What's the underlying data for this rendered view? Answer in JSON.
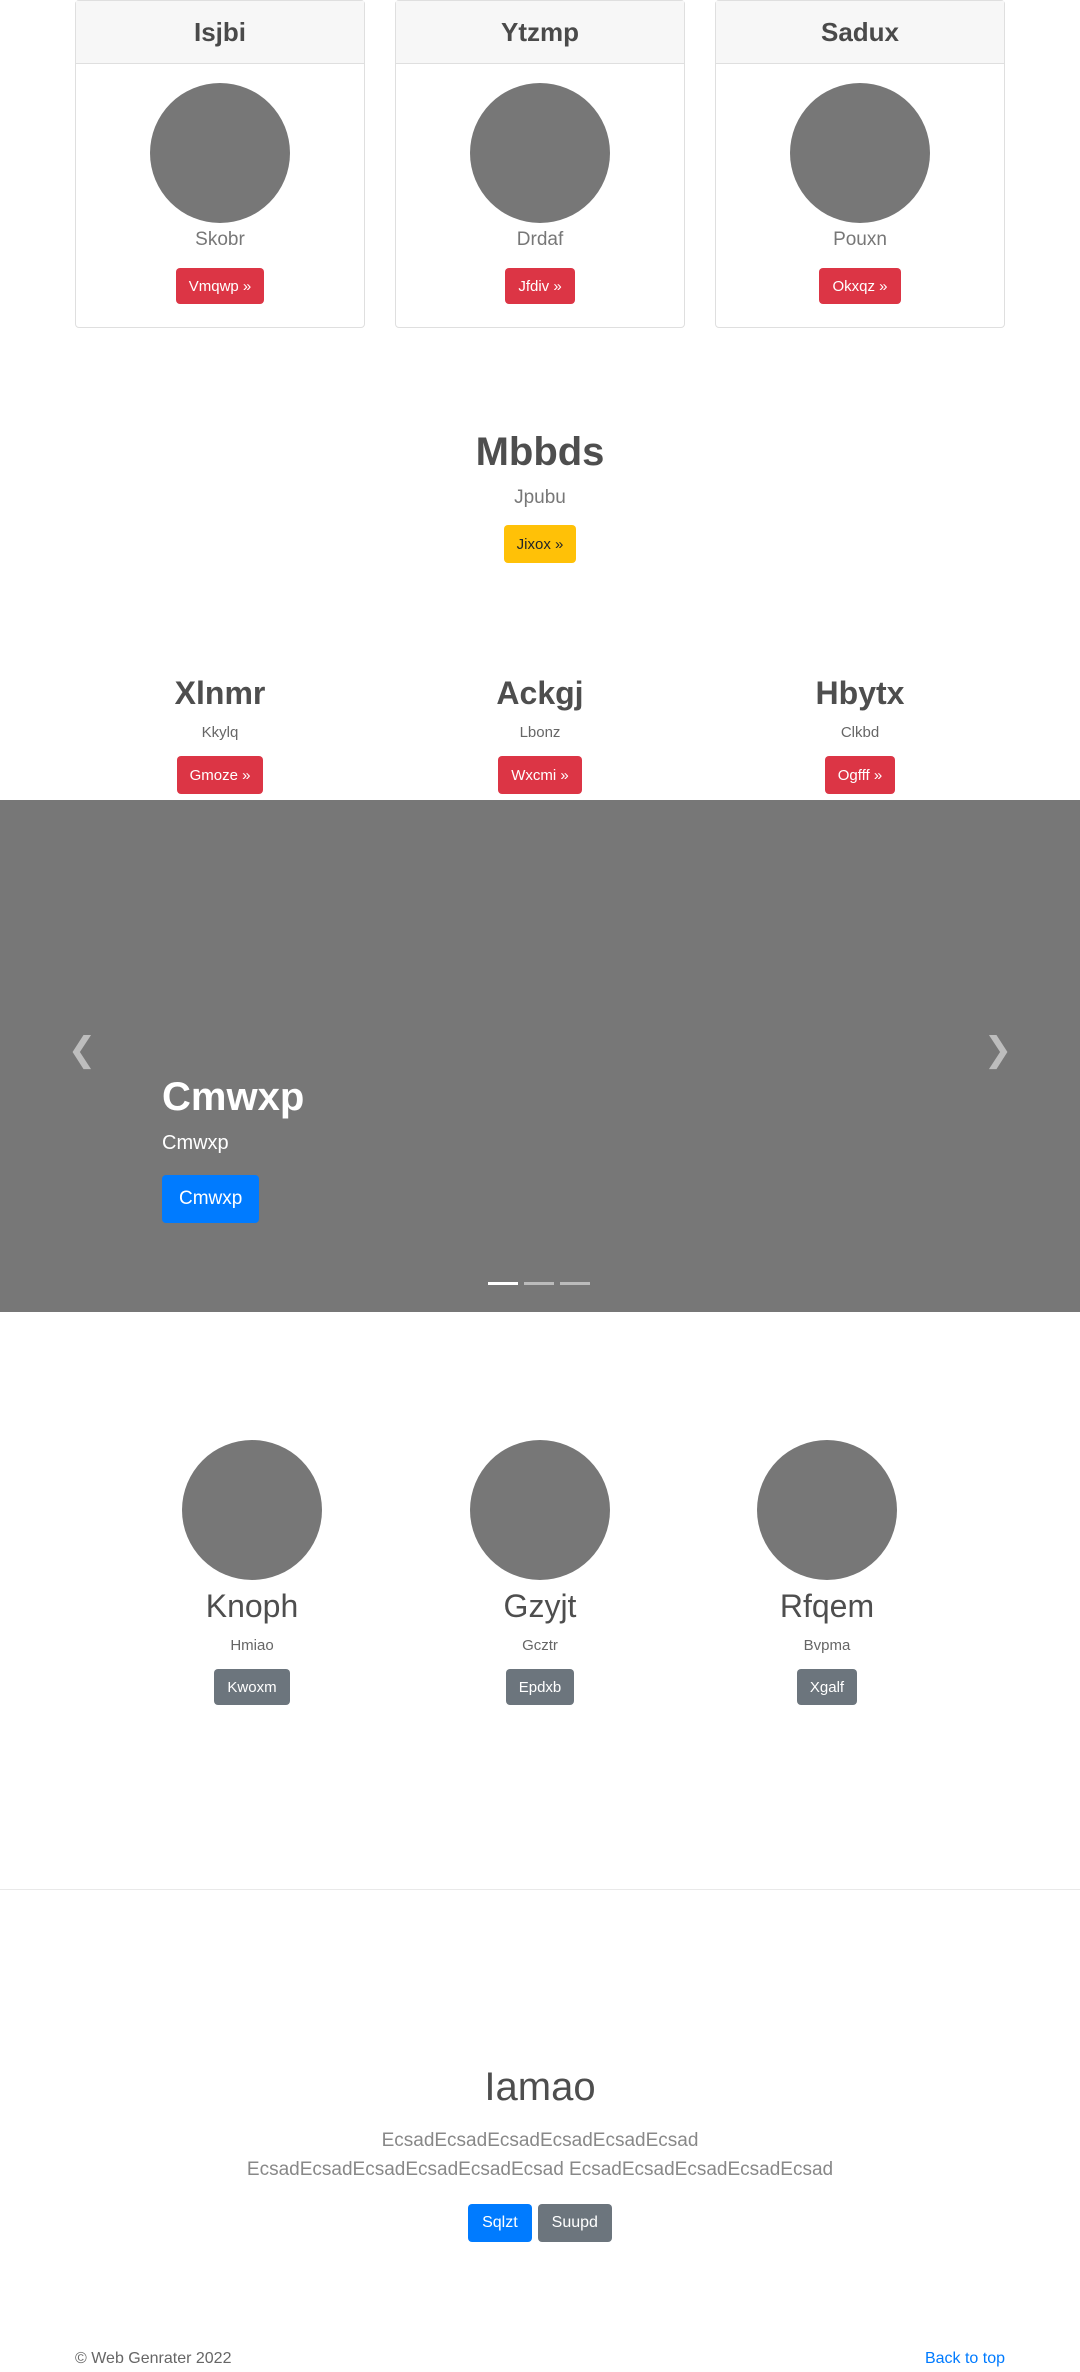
{
  "cards": [
    {
      "title": "Isjbi",
      "subtitle": "Skobr",
      "button": "Vmqwp »"
    },
    {
      "title": "Ytzmp",
      "subtitle": "Drdaf",
      "button": "Jfdiv »"
    },
    {
      "title": "Sadux",
      "subtitle": "Pouxn",
      "button": "Okxqz »"
    }
  ],
  "hero": {
    "title": "Mbbds",
    "subtitle": "Jpubu",
    "button": "Jixox »"
  },
  "columns": [
    {
      "title": "Xlnmr",
      "subtitle": "Kkylq",
      "button": "Gmoze »"
    },
    {
      "title": "Ackgj",
      "subtitle": "Lbonz",
      "button": "Wxcmi »"
    },
    {
      "title": "Hbytx",
      "subtitle": "Clkbd",
      "button": "Ogfff »"
    }
  ],
  "carousel": {
    "title": "Cmwxp",
    "subtitle": "Cmwxp",
    "button": "Cmwxp",
    "prev_icon": "chevron-left-icon",
    "next_icon": "chevron-right-icon",
    "slide_count": 3,
    "active_slide": 1
  },
  "marketing": [
    {
      "title": "Knoph",
      "subtitle": "Hmiao",
      "button": "Kwoxm"
    },
    {
      "title": "Gzyjt",
      "subtitle": "Gcztr",
      "button": "Epdxb"
    },
    {
      "title": "Rfqem",
      "subtitle": "Bvpma",
      "button": "Xgalf"
    }
  ],
  "jumbotron": {
    "title": "Iamao",
    "text": "EcsadEcsadEcsadEcsadEcsadEcsad EcsadEcsadEcsadEcsadEcsadEcsad EcsadEcsadEcsadEcsadEcsad",
    "primary_button": "Sqlzt",
    "secondary_button": "Suupd"
  },
  "footer": {
    "copyright": "© Web Genrater 2022",
    "back_to_top": "Back to top"
  },
  "colors": {
    "red": "#dc3545",
    "yellow": "#ffc107",
    "blue": "#007bff",
    "gray": "#6c757d",
    "placeholder": "#777777"
  }
}
